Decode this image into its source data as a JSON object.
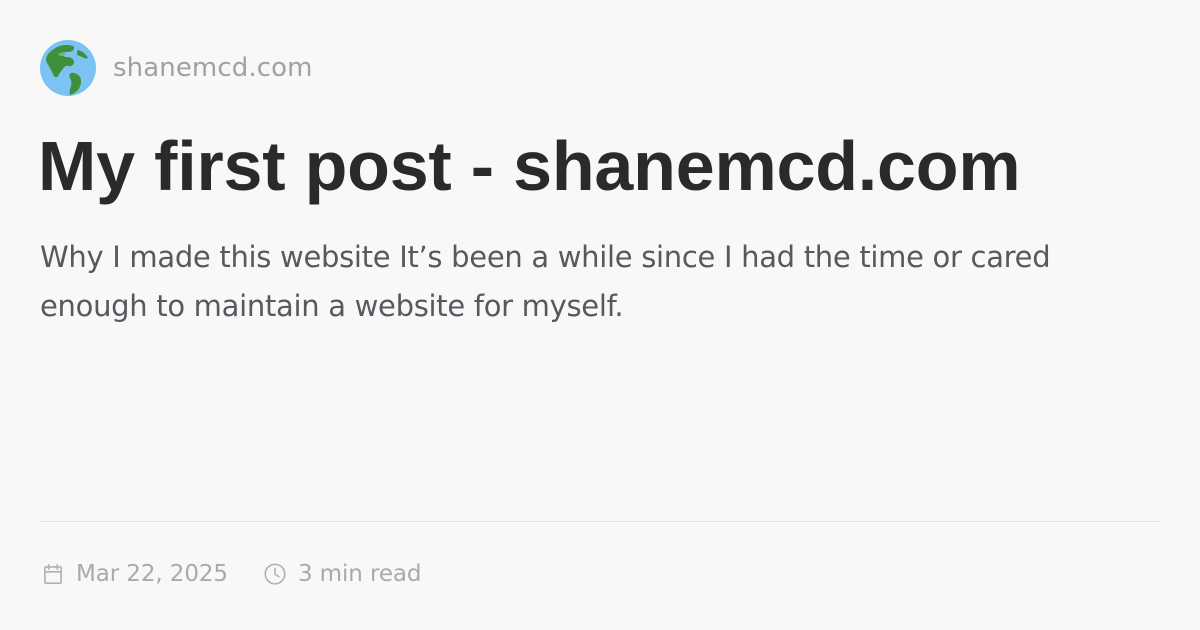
{
  "site": {
    "name": "shanemcd.com",
    "icon": "globe-americas-icon"
  },
  "post": {
    "title": "My first post - shanemcd.com",
    "summary": "Why I made this website It’s been a while since I had the time or cared enough to maintain a website for myself."
  },
  "meta": {
    "date": "Mar 22, 2025",
    "date_icon": "calendar-icon",
    "read_time": "3 min read",
    "read_time_icon": "clock-icon"
  },
  "colors": {
    "background": "#f9f8f9",
    "title": "#2a292c",
    "summary": "#59585e",
    "muted": "#a0a0a6",
    "divider": "#e4e3e6",
    "globe_ocean": "#7cc3f3",
    "globe_land": "#3f8f3b"
  }
}
